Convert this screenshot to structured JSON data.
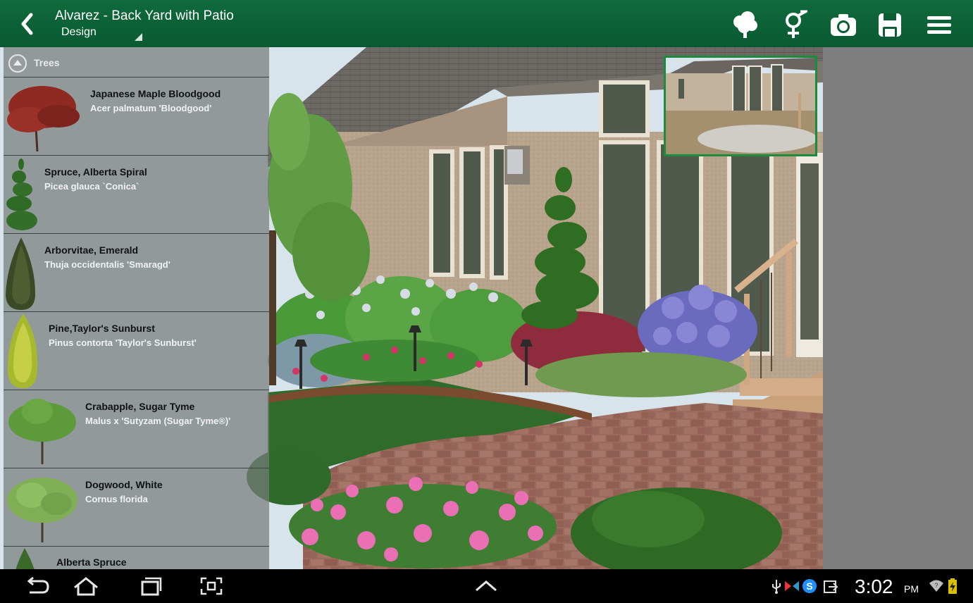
{
  "header": {
    "title": "Alvarez - Back Yard with Patio",
    "subtitle": "Design",
    "back_icon": "chevron-left-icon",
    "actions": [
      "tree-icon",
      "search-plant-icon",
      "camera-icon",
      "save-icon",
      "menu-icon"
    ]
  },
  "sidebar": {
    "category": "Trees",
    "items": [
      {
        "name": "Japanese Maple Bloodgood",
        "latin": "Acer palmatum 'Bloodgood'"
      },
      {
        "name": "Spruce, Alberta Spiral",
        "latin": "Picea glauca `Conica`"
      },
      {
        "name": "Arborvitae, Emerald",
        "latin": "Thuja occidentalis 'Smaragd'"
      },
      {
        "name": "Pine,Taylor's Sunburst",
        "latin": "Pinus contorta 'Taylor's Sunburst'"
      },
      {
        "name": "Crabapple, Sugar Tyme",
        "latin": "Malus x 'Sutyzam (Sugar Tyme®)'"
      },
      {
        "name": "Dogwood, White",
        "latin": "Cornus florida"
      },
      {
        "name": "Alberta Spruce",
        "latin": ""
      }
    ]
  },
  "statusbar": {
    "time": "3:02",
    "ampm": "PM"
  },
  "colors": {
    "actionbar": "#0b5e34",
    "thumbnail_border": "#1d8b3d"
  }
}
